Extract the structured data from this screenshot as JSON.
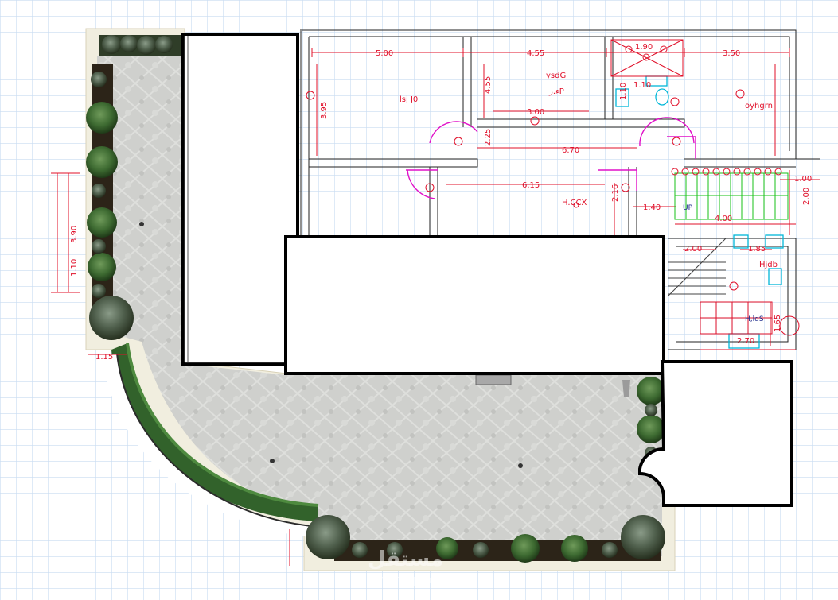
{
  "dimensions": {
    "top_row": [
      "5.00",
      "4.55",
      "1.90",
      "3.50"
    ],
    "left_verticals": [
      "3.95",
      "4.55",
      "2.25"
    ],
    "mid_row": [
      "3.00",
      "6.70",
      "6.15",
      "1.40",
      "2.16"
    ],
    "right_side": [
      "1.00",
      "2.00",
      "4.00",
      "2.00",
      "1.85",
      "1.65",
      "2.70"
    ],
    "garden_left": [
      "3.90",
      "1.10"
    ],
    "small": [
      "1.10",
      "1.10",
      "1.15"
    ]
  },
  "room_labels": {
    "majlis": "ysdG",
    "majlis_sub": "ﺀ.ﺭP",
    "room_left": "lsj J0",
    "room_right": "oyhgrn",
    "lobby": "Hjdb",
    "bath": "H,ldS",
    "small_mark": "H.CCX"
  },
  "stair_label": "UP",
  "watermark": {
    "arabic": "مستقل",
    "latin": "mostaql.com"
  },
  "colors": {
    "grid": "#c9dcf2",
    "cad_red": "#e0102a",
    "cad_magenta": "#e010c8",
    "cad_green": "#17c217",
    "cad_cyan": "#00b7d8",
    "pavement": "#cfd0cd",
    "hedge": "#3a6e30",
    "shrub": "#2f4f26"
  }
}
